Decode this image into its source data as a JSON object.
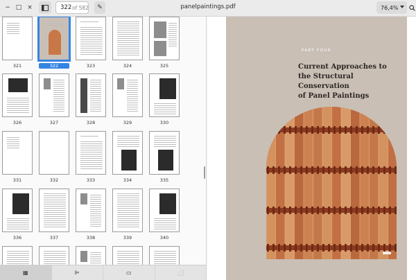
{
  "header": {
    "current_page": "322",
    "page_total": "of 582",
    "title": "panelpaintings.pdf",
    "zoom": "76,4%",
    "icons": [
      "minimize-icon",
      "maximize-icon",
      "close-icon",
      "sidebar-toggle-icon",
      "annotate-pencil-icon",
      "search-icon",
      "chevron-down-icon"
    ]
  },
  "sidebar": {
    "thumbnails": [
      {
        "label": "321"
      },
      {
        "label": "322",
        "selected": true
      },
      {
        "label": "323"
      },
      {
        "label": "324"
      },
      {
        "label": "325"
      },
      {
        "label": "326"
      },
      {
        "label": "327"
      },
      {
        "label": "328"
      },
      {
        "label": "329"
      },
      {
        "label": "330"
      },
      {
        "label": "331"
      },
      {
        "label": "332"
      },
      {
        "label": "333"
      },
      {
        "label": "334"
      },
      {
        "label": "335"
      },
      {
        "label": "336"
      },
      {
        "label": "337"
      },
      {
        "label": "338"
      },
      {
        "label": "339"
      },
      {
        "label": "340"
      },
      {
        "label": ""
      },
      {
        "label": ""
      },
      {
        "label": ""
      },
      {
        "label": ""
      },
      {
        "label": ""
      }
    ],
    "bottom_tabs": [
      {
        "name": "thumbnails-tab",
        "icon": "grid-icon",
        "glyph": "▦",
        "active": true
      },
      {
        "name": "outline-tab",
        "icon": "outline-icon",
        "glyph": "⊫",
        "active": false
      },
      {
        "name": "annotations-tab",
        "icon": "comment-icon",
        "glyph": "▭",
        "active": false
      },
      {
        "name": "bookmarks-tab",
        "icon": "bookmark-icon",
        "glyph": "⬜",
        "active": false
      }
    ]
  },
  "document": {
    "part_label": "PART FOUR",
    "title_line1": "Current Approaches to",
    "title_line2": "the Structural Conservation",
    "title_line3": "of Panel Paintings"
  },
  "colors": {
    "accent": "#3584e4",
    "page_bg": "#c9bfb5",
    "wood": "#c87846",
    "wood_light": "#d99666",
    "batten": "#8c3a20"
  }
}
